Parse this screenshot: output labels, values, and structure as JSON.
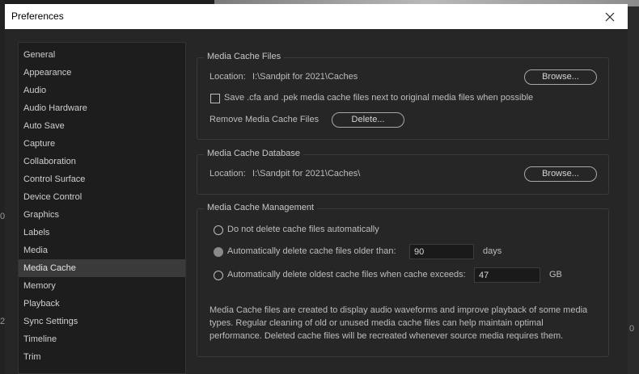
{
  "window": {
    "title": "Preferences",
    "close_icon": "close-icon"
  },
  "sidebar": {
    "items": [
      {
        "label": "General"
      },
      {
        "label": "Appearance"
      },
      {
        "label": "Audio"
      },
      {
        "label": "Audio Hardware"
      },
      {
        "label": "Auto Save"
      },
      {
        "label": "Capture"
      },
      {
        "label": "Collaboration"
      },
      {
        "label": "Control Surface"
      },
      {
        "label": "Device Control"
      },
      {
        "label": "Graphics"
      },
      {
        "label": "Labels"
      },
      {
        "label": "Media"
      },
      {
        "label": "Media Cache"
      },
      {
        "label": "Memory"
      },
      {
        "label": "Playback"
      },
      {
        "label": "Sync Settings"
      },
      {
        "label": "Timeline"
      },
      {
        "label": "Trim"
      }
    ],
    "selected": "Media Cache"
  },
  "media_cache_files": {
    "title": "Media Cache Files",
    "location_label": "Location:",
    "location_value": "I:\\Sandpit for 2021\\Caches",
    "browse_label": "Browse...",
    "save_checkbox_label": "Save .cfa and .pek media cache files next to original media files when possible",
    "save_checked": false,
    "remove_label": "Remove Media Cache Files",
    "delete_label": "Delete..."
  },
  "media_cache_database": {
    "title": "Media Cache Database",
    "location_label": "Location:",
    "location_value": "I:\\Sandpit for 2021\\Caches\\",
    "browse_label": "Browse..."
  },
  "media_cache_management": {
    "title": "Media Cache Management",
    "option_no_delete": "Do not delete cache files automatically",
    "option_older_than": "Automatically delete cache files older than:",
    "older_than_value": "90",
    "older_than_unit": "days",
    "option_exceeds": "Automatically delete oldest cache files when cache exceeds:",
    "exceeds_value": "47",
    "exceeds_unit": "GB",
    "selected_option": "older_than",
    "description": "Media Cache files are created to display audio waveforms and improve playback of some media types.  Regular cleaning of old or unused media cache files can help maintain optimal performance. Deleted cache files will be recreated whenever source media requires them."
  },
  "background": {
    "left_mark_1": "0",
    "left_mark_2": "2",
    "right_mark": "0"
  }
}
